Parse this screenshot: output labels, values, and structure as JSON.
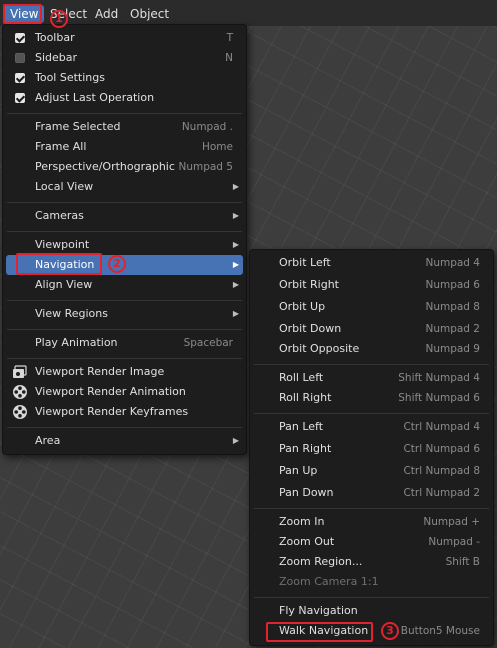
{
  "header": {
    "menus": [
      {
        "label": "View"
      },
      {
        "label": "Select"
      },
      {
        "label": "Add"
      },
      {
        "label": "Object"
      }
    ]
  },
  "view_menu": {
    "items": [
      {
        "label": "Toolbar",
        "shortcut": "T",
        "checked": true
      },
      {
        "label": "Sidebar",
        "shortcut": "N",
        "checked": false
      },
      {
        "label": "Tool Settings",
        "shortcut": "",
        "checked": true
      },
      {
        "label": "Adjust Last Operation",
        "shortcut": "",
        "checked": true
      },
      {
        "label": "Frame Selected",
        "shortcut": "Numpad ."
      },
      {
        "label": "Frame All",
        "shortcut": "Home"
      },
      {
        "label": "Perspective/Orthographic",
        "shortcut": "Numpad 5"
      },
      {
        "label": "Local View",
        "submenu": true
      },
      {
        "label": "Cameras",
        "submenu": true
      },
      {
        "label": "Viewpoint",
        "submenu": true
      },
      {
        "label": "Navigation",
        "submenu": true,
        "selected": true
      },
      {
        "label": "Align View",
        "submenu": true
      },
      {
        "label": "View Regions",
        "submenu": true
      },
      {
        "label": "Play Animation",
        "shortcut": "Spacebar"
      },
      {
        "label": "Viewport Render Image",
        "icon": "render-image-icon"
      },
      {
        "label": "Viewport Render Animation",
        "icon": "render-animation-icon"
      },
      {
        "label": "Viewport Render Keyframes",
        "icon": "render-keyframes-icon"
      },
      {
        "label": "Area",
        "submenu": true
      }
    ]
  },
  "navigation_menu": {
    "items": [
      {
        "label": "Orbit Left",
        "shortcut": "Numpad 4"
      },
      {
        "label": "Orbit Right",
        "shortcut": "Numpad 6"
      },
      {
        "label": "Orbit Up",
        "shortcut": "Numpad 8"
      },
      {
        "label": "Orbit Down",
        "shortcut": "Numpad 2"
      },
      {
        "label": "Orbit Opposite",
        "shortcut": "Numpad 9"
      },
      {
        "label": "Roll Left",
        "shortcut": "Shift Numpad 4"
      },
      {
        "label": "Roll Right",
        "shortcut": "Shift Numpad 6"
      },
      {
        "label": "Pan Left",
        "shortcut": "Ctrl Numpad 4"
      },
      {
        "label": "Pan Right",
        "shortcut": "Ctrl Numpad 6"
      },
      {
        "label": "Pan Up",
        "shortcut": "Ctrl Numpad 8"
      },
      {
        "label": "Pan Down",
        "shortcut": "Ctrl Numpad 2"
      },
      {
        "label": "Zoom In",
        "shortcut": "Numpad +"
      },
      {
        "label": "Zoom Out",
        "shortcut": "Numpad -"
      },
      {
        "label": "Zoom Region...",
        "shortcut": "Shift B"
      },
      {
        "label": "Zoom Camera 1:1",
        "shortcut": "",
        "disabled": true
      },
      {
        "label": "Fly Navigation",
        "shortcut": ""
      },
      {
        "label": "Walk Navigation",
        "shortcut": "Button5 Mouse"
      }
    ]
  },
  "annotations": {
    "step1": "1",
    "step2": "2",
    "step3": "3"
  },
  "colors": {
    "selection": "#4772b3",
    "menu_bg": "#1d1d1d",
    "annotation": "#e2222e"
  }
}
